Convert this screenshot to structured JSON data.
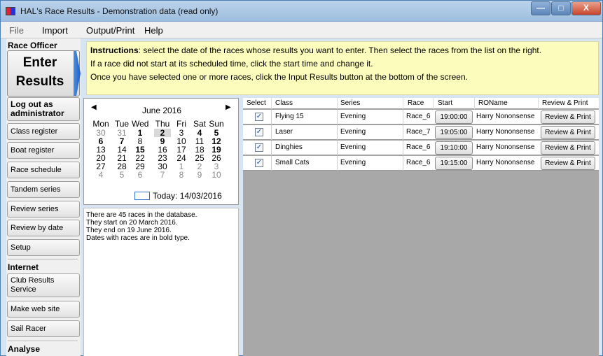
{
  "window": {
    "title": "HAL's Race Results - Demonstration data (read only)",
    "min": "—",
    "max": "□",
    "close": "X"
  },
  "menu": [
    "File",
    "Import",
    "Output/Print",
    "Help"
  ],
  "sidebar": {
    "race_officer": "Race Officer",
    "enter_results": [
      "Enter",
      "Results"
    ],
    "log_out": "Log out as administrator",
    "items": [
      "Class register",
      "Boat register",
      "Race schedule",
      "Tandem series",
      "Review series",
      "Review by date",
      "Setup"
    ],
    "internet": "Internet",
    "internet_items": [
      "Club Results Service",
      "Make web site",
      "Sail Racer"
    ],
    "analyse": "Analyse"
  },
  "instructions": {
    "bold": "Instructions",
    "line1": ": select the date of the races whose results you want to enter.  Then select the races from the list on the right.",
    "line2": "If a race did not start at its scheduled time, click the start time and change it.",
    "line3": "Once you have selected one or more races, click the Input Results button at the bottom of the screen."
  },
  "calendar": {
    "prev": "◀",
    "next": "▶",
    "month": "June 2016",
    "dow": [
      "Mon",
      "Tue",
      "Wed",
      "Thu",
      "Fri",
      "Sat",
      "Sun"
    ],
    "weeks": [
      [
        {
          "d": "30",
          "g": 1
        },
        {
          "d": "31",
          "g": 1
        },
        {
          "d": "1",
          "b": 1
        },
        {
          "d": "2",
          "b": 1,
          "s": 1
        },
        {
          "d": "3"
        },
        {
          "d": "4",
          "b": 1
        },
        {
          "d": "5",
          "b": 1
        }
      ],
      [
        {
          "d": "6",
          "b": 1
        },
        {
          "d": "7",
          "b": 1
        },
        {
          "d": "8"
        },
        {
          "d": "9",
          "b": 1
        },
        {
          "d": "10"
        },
        {
          "d": "11"
        },
        {
          "d": "12",
          "b": 1
        }
      ],
      [
        {
          "d": "13"
        },
        {
          "d": "14"
        },
        {
          "d": "15",
          "b": 1
        },
        {
          "d": "16"
        },
        {
          "d": "17"
        },
        {
          "d": "18"
        },
        {
          "d": "19",
          "b": 1
        }
      ],
      [
        {
          "d": "20"
        },
        {
          "d": "21"
        },
        {
          "d": "22"
        },
        {
          "d": "23"
        },
        {
          "d": "24"
        },
        {
          "d": "25"
        },
        {
          "d": "26"
        }
      ],
      [
        {
          "d": "27"
        },
        {
          "d": "28"
        },
        {
          "d": "29"
        },
        {
          "d": "30"
        },
        {
          "d": "1",
          "g": 1
        },
        {
          "d": "2",
          "g": 1
        },
        {
          "d": "3",
          "g": 1
        }
      ],
      [
        {
          "d": "4",
          "g": 1
        },
        {
          "d": "5",
          "g": 1
        },
        {
          "d": "6",
          "g": 1
        },
        {
          "d": "7",
          "g": 1
        },
        {
          "d": "8",
          "g": 1
        },
        {
          "d": "9",
          "g": 1
        },
        {
          "d": "10",
          "g": 1
        }
      ]
    ],
    "today": "Today: 14/03/2016"
  },
  "info": [
    "There are 45 races in the database.",
    "They start on 20 March 2016.",
    "They end on 19 June 2016.",
    "Dates with races are in bold type."
  ],
  "grid": {
    "headers": [
      "Select",
      "Class",
      "Series",
      "Race",
      "Start",
      "ROName",
      "Review & Print"
    ],
    "check_mark": "✓",
    "rows": [
      {
        "class": "Flying 15",
        "series": "Evening",
        "race": "Race_6",
        "start": "19:00:00",
        "ro": "Harry Nononsense",
        "action": "Review & Print"
      },
      {
        "class": "Laser",
        "series": "Evening",
        "race": "Race_7",
        "start": "19:05:00",
        "ro": "Harry Nononsense",
        "action": "Review & Print"
      },
      {
        "class": "Dinghies",
        "series": "Evening",
        "race": "Race_6",
        "start": "19:10:00",
        "ro": "Harry Nononsense",
        "action": "Review & Print"
      },
      {
        "class": "Small Cats",
        "series": "Evening",
        "race": "Race_6",
        "start": "19:15:00",
        "ro": "Harry Nononsense",
        "action": "Review & Print"
      }
    ]
  },
  "colors": {
    "instructions_bg": "#fcfcbc",
    "grid_bg": "#a8a8a8",
    "today_outline": "#2e74c9"
  }
}
